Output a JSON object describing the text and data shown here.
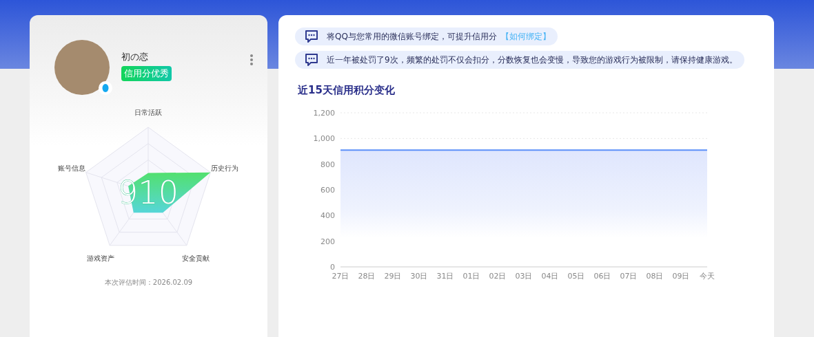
{
  "profile": {
    "name": "初の恋",
    "badge": "信用分优秀",
    "score": "910",
    "radar_labels": [
      "日常活跃",
      "历史行为",
      "安全贡献",
      "游戏资产",
      "账号信息"
    ],
    "evaluated": "本次评估时间：2026.02.09"
  },
  "notices": [
    {
      "text": "将QQ与您常用的微信账号绑定，可提升信用分",
      "link": "【如何绑定】"
    },
    {
      "text": "近一年被处罚了9次，频繁的处罚不仅会扣分，分数恢复也会变慢，导致您的游戏行为被限制，请保持健康游戏。"
    }
  ],
  "credit_chart": {
    "chart_data": {
      "type": "area",
      "title": "近15天信用积分变化",
      "categories": [
        "27日",
        "28日",
        "29日",
        "30日",
        "31日",
        "01日",
        "02日",
        "03日",
        "04日",
        "05日",
        "06日",
        "07日",
        "08日",
        "09日",
        "今天"
      ],
      "series": [
        {
          "color": "#5b8ff9",
          "values": [
            910,
            910,
            910,
            910,
            910,
            910,
            910,
            910,
            910,
            910,
            910,
            910,
            910,
            910,
            910
          ]
        }
      ],
      "ylim": [
        0,
        1200
      ],
      "yticks": [
        0,
        200,
        400,
        600,
        800,
        {
          "value": 1000,
          "label": "1,000"
        },
        {
          "value": 1200,
          "label": "1,200"
        }
      ]
    }
  }
}
